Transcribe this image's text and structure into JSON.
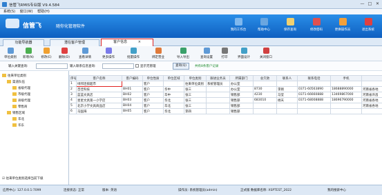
{
  "window": {
    "title": "信管飞RMIS专业版 V9.4.584",
    "min": "—",
    "max": "□",
    "close": "✕"
  },
  "menu": [
    "系统(S)",
    "窗口(W)",
    "帮助(H)"
  ],
  "banner": {
    "brand": "信管飞",
    "slogan": "随你化管理软件"
  },
  "nav_tools": [
    {
      "label": "我的工作台",
      "icon": "desktop-icon",
      "color": "#7fb8ee"
    },
    {
      "label": "帮助中心",
      "icon": "help-icon",
      "color": "#6aa6e0"
    },
    {
      "label": "保存查询",
      "icon": "mail-icon",
      "color": "#f0d070"
    },
    {
      "label": "修改密码",
      "icon": "key-icon",
      "color": "#e05050"
    },
    {
      "label": "更换操作员",
      "icon": "user-icon",
      "color": "#f3a03a"
    },
    {
      "label": "退出系统",
      "icon": "exit-icon",
      "color": "#e04040"
    }
  ],
  "tabs": [
    "功能导航器",
    "潜在客户管理",
    "客户信息"
  ],
  "toolbar": [
    "单位类别",
    "新增(N)",
    "修改(E)",
    "删除(D)",
    "查看详情",
    "更多操作",
    "批量操作",
    "绑定营业",
    "导入导出",
    "查询设置",
    "打印",
    "界面设计",
    "关闭窗口"
  ],
  "filter": {
    "search_label": "输入关键查询:",
    "contact_label": "输入联系信息查询:",
    "show_no_mgr": "显示无管理",
    "query_btn": "查询(Q)",
    "count": "共有8条客户记录"
  },
  "tree": {
    "root": "往来单位类别",
    "nodes": [
      {
        "label": "渠道队伍",
        "level": 1
      },
      {
        "label": "省级代理",
        "level": 2
      },
      {
        "label": "市级代理",
        "level": 2
      },
      {
        "label": "县级代理",
        "level": 2
      },
      {
        "label": "零售商",
        "level": 2
      },
      {
        "label": "销售区域",
        "level": 1
      },
      {
        "label": "华北",
        "level": 2
      },
      {
        "label": "华东",
        "level": 2
      }
    ],
    "footer": "往来单位类别选择当前下级"
  },
  "table": {
    "headers": [
      "序号",
      "客户名称",
      "客户编码",
      "单位性质",
      "单位区域",
      "单位类别",
      "跟进业务员",
      "所属部门",
      "总欠款",
      "联系人",
      "联系电话",
      "手机",
      ""
    ],
    "rows": [
      [
        "1",
        "绿邦连锁超市",
        "",
        "客户",
        "",
        "往来单位类别",
        "系统管理员",
        "办公室",
        "",
        "",
        "",
        "",
        ""
      ],
      [
        "2",
        "百佳科技",
        "BH01",
        "客户",
        "华中",
        "张三",
        "",
        "办公室",
        "8730",
        "李刚",
        "0371-60563890",
        "18688890000",
        "河南省各地"
      ],
      [
        "3",
        "蓝蓝文具店",
        "BH02",
        "客户",
        "华中",
        "张三",
        "",
        "销售部",
        "4230",
        "马莹",
        "0371-66660888",
        "13469867000",
        "河南省许昌"
      ],
      [
        "4",
        "星星文具第一小学店",
        "BH03",
        "客户",
        "华北",
        "张三",
        "",
        "销售部",
        "683010",
        "杨天",
        "0371-68008888",
        "18696790000",
        "河南省各地"
      ],
      [
        "5",
        "北京小学文具商品店",
        "BH04",
        "客户",
        "华北",
        "张三",
        "",
        "销售部",
        "",
        "",
        "",
        "",
        "河南省各地"
      ],
      [
        "6",
        "马国海",
        "BH05",
        "客户",
        "华北",
        "李四",
        "",
        "销售部",
        "",
        "",
        "",
        "",
        ""
      ]
    ]
  },
  "status": {
    "server": "应用中心: 127.0.0.1:7099",
    "conn": "连接状态: 正常",
    "version": "版本: 英语",
    "operator": "操作员: 系统管理员(admin)",
    "db": "正式版 数据库名称: XSPTEST_2022",
    "vip": "我的搜索中心"
  }
}
